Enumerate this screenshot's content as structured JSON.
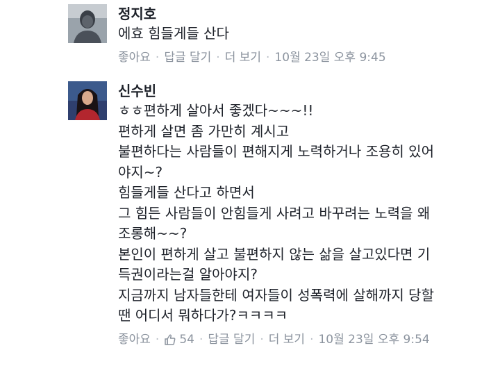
{
  "comments": [
    {
      "author": "정지호",
      "lines": [
        "에효 힘들게들 산다"
      ],
      "meta": {
        "like": "좋아요",
        "reply": "답글 달기",
        "more": "더 보기",
        "timestamp": "10월 23일 오후 9:45"
      }
    },
    {
      "author": "신수빈",
      "lines": [
        "ㅎㅎ편하게 살아서 좋겠다~~~!!",
        "편하게 살면 좀 가만히 계시고",
        "불편하다는 사람들이 편해지게 노력하거나 조용히 있어",
        "야지~?",
        "힘들게들 산다고 하면서",
        "그 힘든 사람들이 안힘들게 사려고 바꾸려는 노력을 왜",
        "조롱해~~?",
        "본인이 편하게 살고 불편하지 않는 삶을 살고있다면 기",
        "득권이라는걸 알아야지?",
        "지금까지 남자들한테 여자들이 성폭력에 살해까지 당할",
        "땐 어디서 뭐하다가?ㅋㅋㅋㅋ"
      ],
      "meta": {
        "like": "좋아요",
        "like_count": "54",
        "reply": "답글 달기",
        "more": "더 보기",
        "timestamp": "10월 23일 오후 9:54"
      }
    }
  ],
  "separator": "·",
  "icons": {
    "thumbs_up": "thumbs-up-icon"
  },
  "colors": {
    "meta_text": "#8b939e",
    "like_accent": "#5890ff",
    "body_text": "#1d2129"
  }
}
